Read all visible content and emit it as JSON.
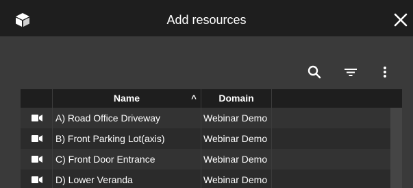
{
  "dialog": {
    "title": "Add resources",
    "logo_icon": "cube-icon",
    "close_icon": "close-icon"
  },
  "toolbar": {
    "icons": [
      "search-icon",
      "filter-icon",
      "more-vert-icon"
    ]
  },
  "table": {
    "columns": {
      "name": "Name",
      "name_sort_indicator": "^",
      "domain": "Domain"
    },
    "row_icon": "video-camera-icon",
    "rows": [
      {
        "name": "A) Road Office Driveway",
        "domain": "Webinar Demo"
      },
      {
        "name": "B) Front Parking Lot(axis)",
        "domain": "Webinar Demo"
      },
      {
        "name": "C) Front Door Entrance",
        "domain": "Webinar Demo"
      },
      {
        "name": "D) Lower Veranda",
        "domain": "Webinar Demo"
      }
    ]
  },
  "colors": {
    "titlebar": "#1e1e1e",
    "body": "#3a3a3a",
    "row_odd": "#333333",
    "row_even": "#2b2b2b"
  }
}
